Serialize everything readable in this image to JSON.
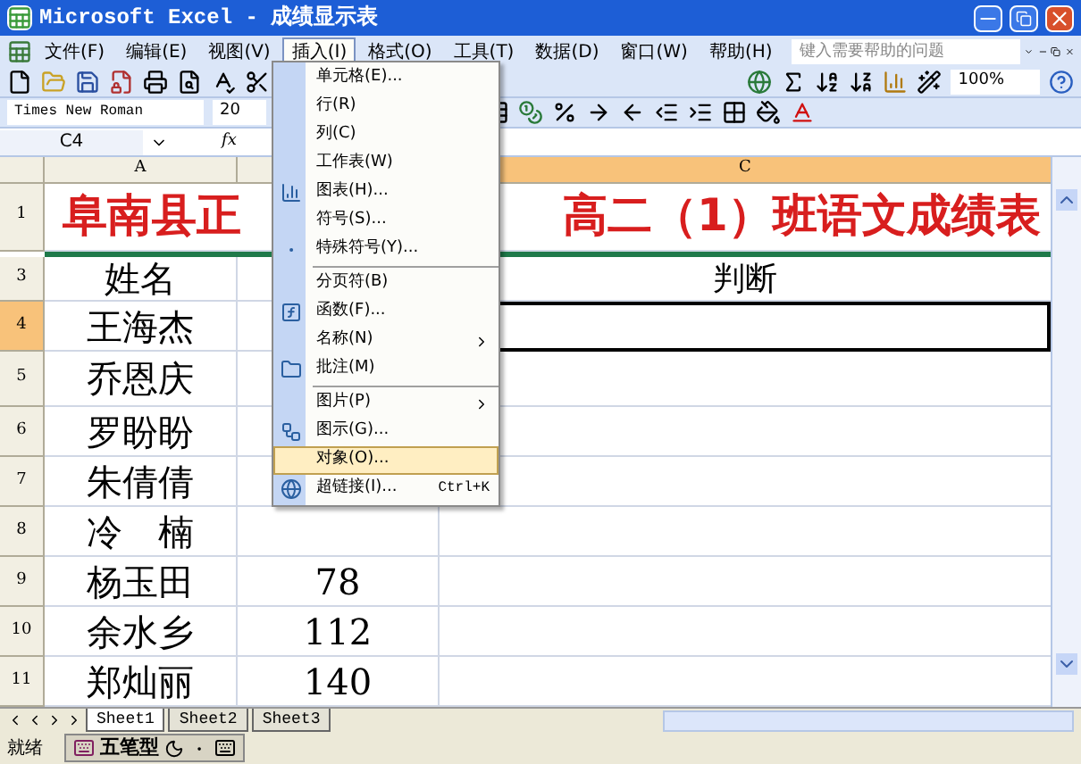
{
  "window": {
    "title": "Microsoft Excel - 成绩显示表"
  },
  "menu_bar": {
    "items": [
      {
        "label": "文件(F)",
        "selected": false
      },
      {
        "label": "编辑(E)",
        "selected": false
      },
      {
        "label": "视图(V)",
        "selected": false
      },
      {
        "label": "插入(I)",
        "selected": true
      },
      {
        "label": "格式(O)",
        "selected": false
      },
      {
        "label": "工具(T)",
        "selected": false
      },
      {
        "label": "数据(D)",
        "selected": false
      },
      {
        "label": "窗口(W)",
        "selected": false
      },
      {
        "label": "帮助(H)",
        "selected": false
      }
    ],
    "help_placeholder": "键入需要帮助的问题"
  },
  "standard_toolbar": {
    "zoom": "100%"
  },
  "formatting_toolbar": {
    "font": "Times New Roman",
    "size": "20"
  },
  "formula_bar": {
    "name_box": "C4",
    "fx": "fx"
  },
  "sheet": {
    "columns": [
      {
        "label": "A",
        "selected": false
      },
      {
        "label": "C",
        "selected": true
      }
    ],
    "rows": [
      {
        "header": "1",
        "kind": "title",
        "selected": false,
        "a": "阜南县正",
        "c": "高二（1）班语文成绩表"
      },
      {
        "header": "3",
        "kind": "data",
        "selected": false,
        "a": "姓名",
        "c": "判断"
      },
      {
        "header": "4",
        "kind": "data",
        "selected": true,
        "a": "王海杰"
      },
      {
        "header": "5",
        "kind": "data",
        "selected": false,
        "a": "乔恩庆"
      },
      {
        "header": "6",
        "kind": "data",
        "selected": false,
        "a": "罗盼盼"
      },
      {
        "header": "7",
        "kind": "data",
        "selected": false,
        "a": "朱倩倩"
      },
      {
        "header": "8",
        "kind": "data",
        "selected": false,
        "a": "冷　楠"
      },
      {
        "header": "9",
        "kind": "data",
        "selected": false,
        "a": "杨玉田",
        "b": "78"
      },
      {
        "header": "10",
        "kind": "data",
        "selected": false,
        "a": "余水乡",
        "b": "112"
      },
      {
        "header": "11",
        "kind": "data",
        "selected": false,
        "a": "郑灿丽",
        "b": "140"
      }
    ]
  },
  "insert_menu": {
    "items": [
      {
        "kind": "item",
        "label": "单元格(E)...",
        "selected": false
      },
      {
        "kind": "item",
        "label": "行(R)",
        "selected": false
      },
      {
        "kind": "item",
        "label": "列(C)",
        "selected": false
      },
      {
        "kind": "item",
        "label": "工作表(W)",
        "selected": false
      },
      {
        "kind": "item",
        "label": "图表(H)...",
        "selected": false
      },
      {
        "kind": "item",
        "label": "符号(S)...",
        "selected": false
      },
      {
        "kind": "item",
        "label": "特殊符号(Y)...",
        "selected": false
      },
      {
        "kind": "separator"
      },
      {
        "kind": "item",
        "label": "分页符(B)",
        "selected": false
      },
      {
        "kind": "item",
        "label": "函数(F)...",
        "selected": false
      },
      {
        "kind": "submenu",
        "label": "名称(N)",
        "selected": false
      },
      {
        "kind": "item",
        "label": "批注(M)",
        "selected": false
      },
      {
        "kind": "separator"
      },
      {
        "kind": "submenu",
        "label": "图片(P)",
        "selected": false
      },
      {
        "kind": "item",
        "label": "图示(G)...",
        "selected": false
      },
      {
        "kind": "item",
        "label": "对象(O)...",
        "selected": true
      },
      {
        "kind": "item",
        "label": "超链接(I)...",
        "shortcut": "Ctrl+K",
        "selected": false
      }
    ]
  },
  "sheet_tabs": [
    {
      "label": "Sheet1",
      "selected": true
    },
    {
      "label": "Sheet2",
      "selected": false
    },
    {
      "label": "Sheet3",
      "selected": false
    }
  ],
  "status_bar": {
    "status": "就绪",
    "ime": "五笔型"
  }
}
